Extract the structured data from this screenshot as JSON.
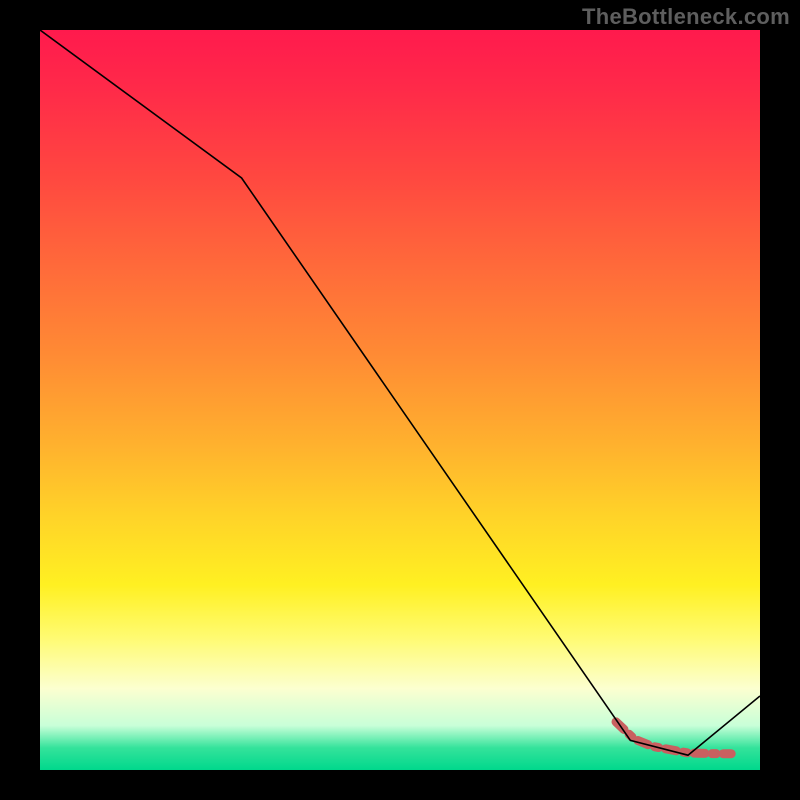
{
  "watermark": "TheBottleneck.com",
  "chart_data": {
    "type": "line",
    "title": "",
    "xlabel": "",
    "ylabel": "",
    "xlim": [
      0,
      100
    ],
    "ylim": [
      0,
      100
    ],
    "series": [
      {
        "name": "curve",
        "color": "#000000",
        "width": 1.6,
        "x": [
          0,
          28,
          82,
          90,
          100
        ],
        "y": [
          100,
          80,
          4,
          2,
          10
        ]
      },
      {
        "name": "highlight",
        "color": "#c96060",
        "width": 9,
        "dash": [
          11,
          7,
          4,
          7
        ],
        "linecap": "round",
        "x": [
          80,
          82.5,
          85,
          90,
          94,
          96
        ],
        "y": [
          6.5,
          4.2,
          3.2,
          2.3,
          2.2,
          2.2
        ]
      }
    ],
    "background_gradient": {
      "stops": [
        {
          "pos": 0,
          "color": "#ff1a4d"
        },
        {
          "pos": 20,
          "color": "#ff4840"
        },
        {
          "pos": 44,
          "color": "#ff8b34"
        },
        {
          "pos": 66,
          "color": "#ffd428"
        },
        {
          "pos": 82,
          "color": "#fffb70"
        },
        {
          "pos": 94,
          "color": "#c8ffd8"
        },
        {
          "pos": 100,
          "color": "#00d88c"
        }
      ]
    }
  }
}
